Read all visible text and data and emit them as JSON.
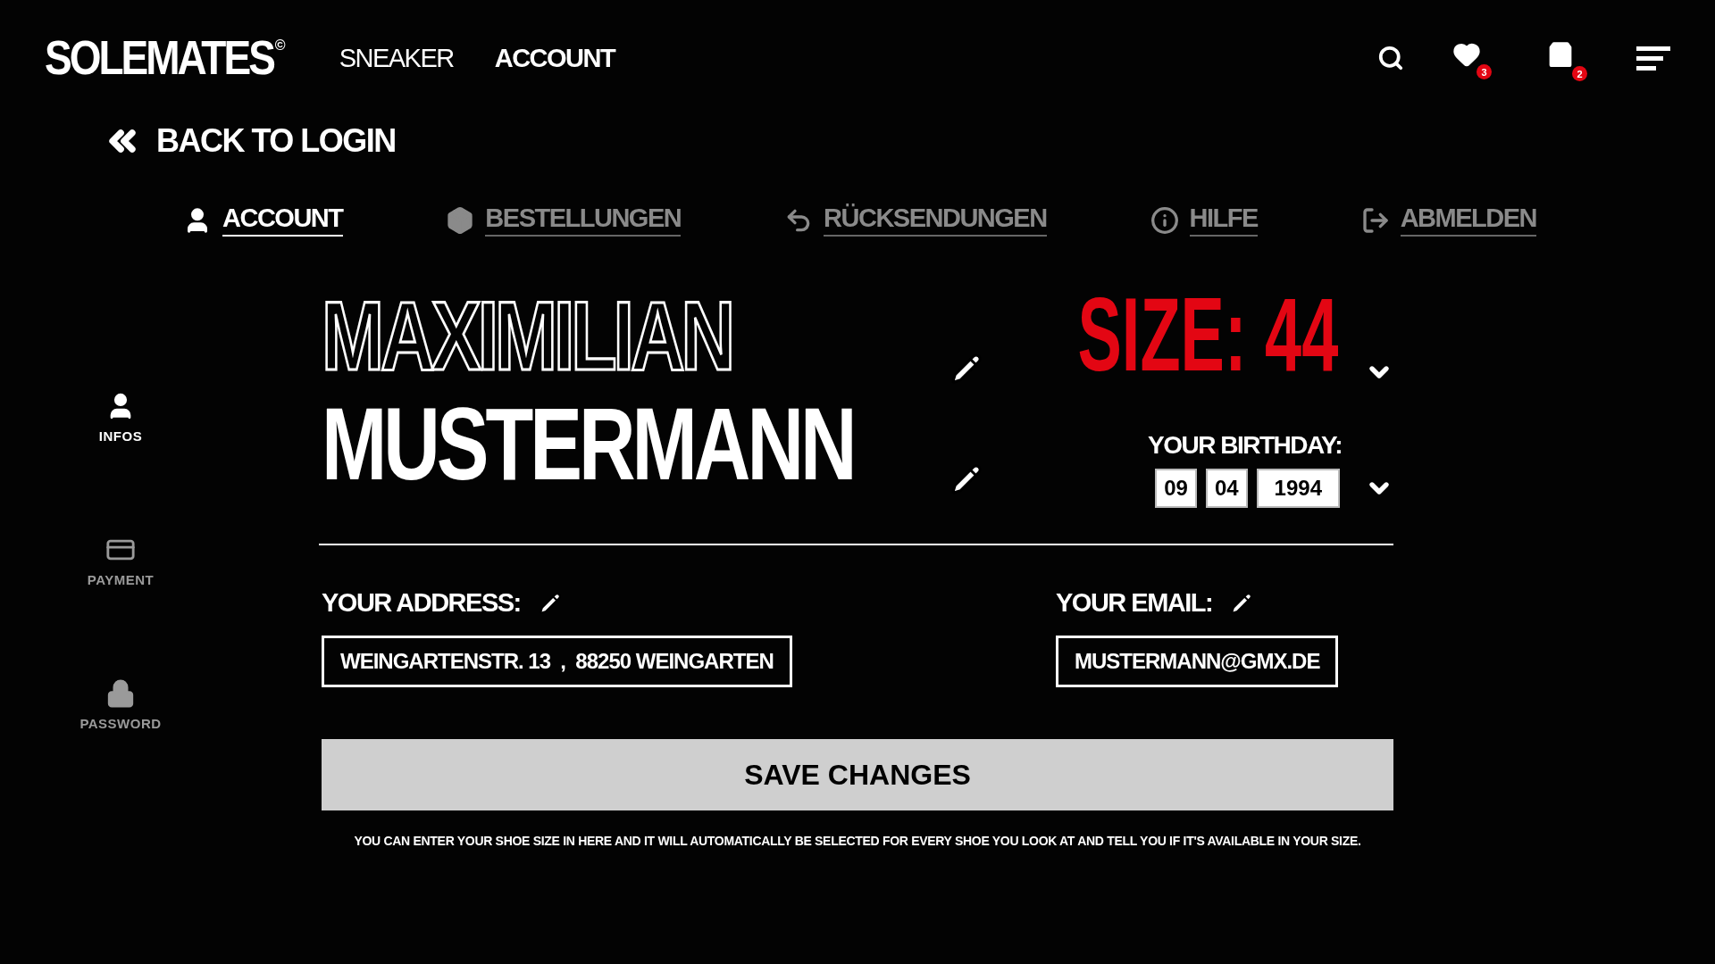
{
  "header": {
    "logo": "SOLEMATES",
    "logo_mark": "©",
    "nav": [
      {
        "label": "SNEAKER",
        "selected": false
      },
      {
        "label": "ACCOUNT",
        "selected": true
      }
    ],
    "wishlist_count": "3",
    "cart_count": "2"
  },
  "back_link": "BACK TO LOGIN",
  "tabs": [
    {
      "label": "ACCOUNT",
      "selected": true
    },
    {
      "label": "BESTELLUNGEN",
      "selected": false
    },
    {
      "label": "RÜCKSENDUNGEN",
      "selected": false
    },
    {
      "label": "HILFE",
      "selected": false
    },
    {
      "label": "ABMELDEN",
      "selected": false
    }
  ],
  "sidebar": {
    "items": [
      {
        "label": "INFOS",
        "selected": true
      },
      {
        "label": "PAYMENT",
        "selected": false
      },
      {
        "label": "PASSWORD",
        "selected": false
      }
    ]
  },
  "profile": {
    "first_name": "MAXIMILIAN",
    "last_name": "MUSTERMANN",
    "size": "SIZE: 44",
    "birthday_label": "YOUR BIRTHDAY:",
    "birthday": {
      "day": "09",
      "month": "04",
      "year": "1994"
    },
    "address_label": "YOUR ADDRESS:",
    "address": "WEINGARTENSTR. 13  ,  88250 WEINGARTEN",
    "email_label": "YOUR EMAIL:",
    "email": "MUSTERMANN@GMX.DE"
  },
  "save_button": "SAVE CHANGES",
  "note": "YOU CAN ENTER YOUR SHOE SIZE IN HERE AND IT WILL AUTOMATICALLY BE SELECTED FOR EVERY SHOE YOU LOOK AT AND TELL YOU IF IT'S AVAILABLE IN YOUR SIZE."
}
